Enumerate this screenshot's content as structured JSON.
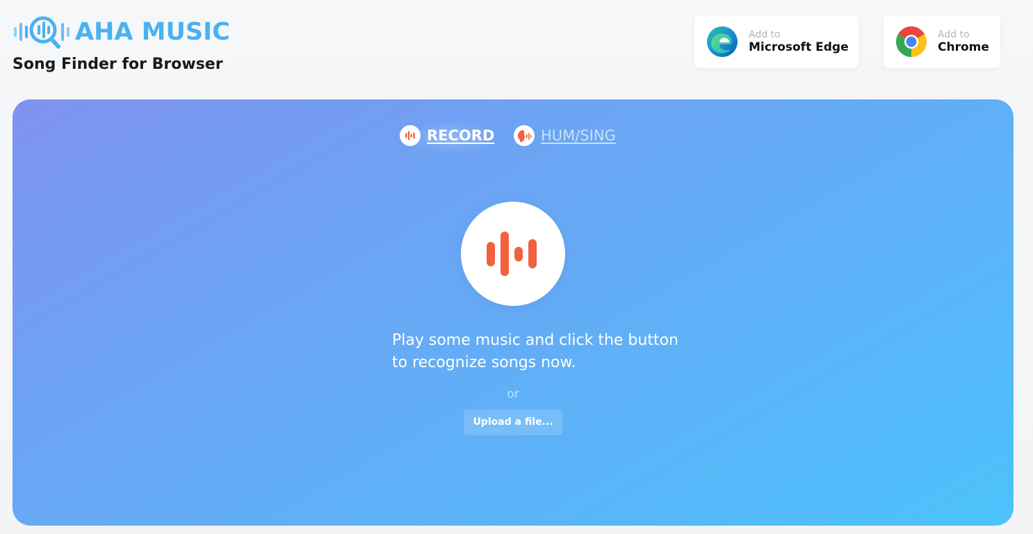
{
  "header": {
    "brand": "AHA MUSIC",
    "tagline": "Song Finder for Browser",
    "logo_icon": "magnifier-soundwave-icon",
    "brand_color": "#4ab2ef"
  },
  "extensions": [
    {
      "small": "Add to",
      "name": "Microsoft Edge",
      "icon": "edge-icon"
    },
    {
      "small": "Add to",
      "name": "Chrome",
      "icon": "chrome-icon"
    }
  ],
  "main": {
    "tabs": [
      {
        "label": "RECORD",
        "icon": "soundwave-icon",
        "active": true
      },
      {
        "label": "HUM/SING",
        "icon": "hum-icon",
        "active": false
      }
    ],
    "record_icon": "soundwave-icon",
    "prompt": "Play some music and click the button to recognize songs now.",
    "or": "or",
    "upload_label": "Upload a file...",
    "accent_color": "#f2613e",
    "gradient_start": "#7f92ef",
    "gradient_end": "#4cc2fb"
  }
}
